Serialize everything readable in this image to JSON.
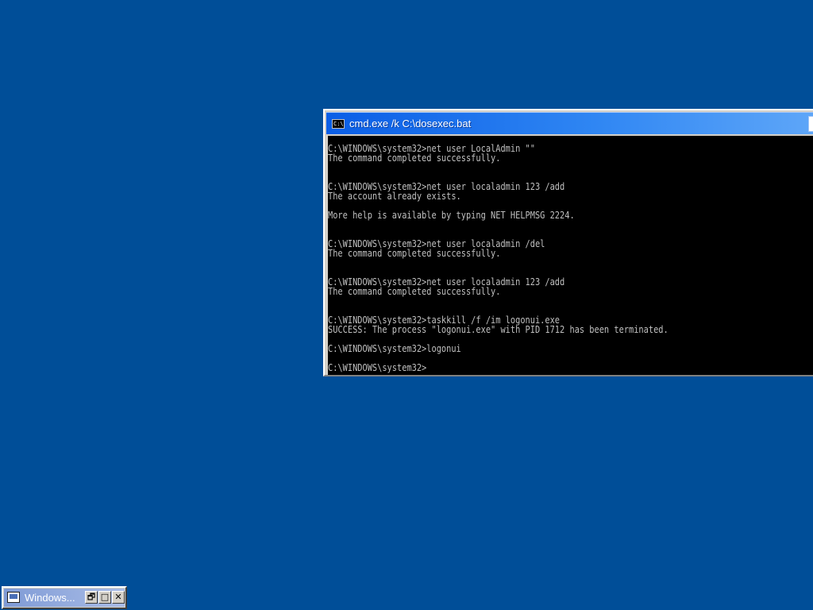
{
  "desktop": {
    "background_color": "#004e98"
  },
  "console_window": {
    "title": "cmd.exe /k C:\\dosexec.bat",
    "title_icon_label": "C:\\",
    "icon": "console-icon",
    "lines": [
      "C:\\WINDOWS\\system32>net user LocalAdmin \"\"",
      "The command completed successfully.",
      "",
      "",
      "C:\\WINDOWS\\system32>net user localadmin 123 /add",
      "The account already exists.",
      "",
      "More help is available by typing NET HELPMSG 2224.",
      "",
      "",
      "C:\\WINDOWS\\system32>net user localadmin /del",
      "The command completed successfully.",
      "",
      "",
      "C:\\WINDOWS\\system32>net user localadmin 123 /add",
      "The command completed successfully.",
      "",
      "",
      "C:\\WINDOWS\\system32>taskkill /f /im logonui.exe",
      "SUCCESS: The process \"logonui.exe\" with PID 1712 has been terminated.",
      "",
      "C:\\WINDOWS\\system32>logonui",
      "",
      "C:\\WINDOWS\\system32>"
    ]
  },
  "minimized_window": {
    "title": "Windows...",
    "icon": "computer-icon",
    "restore_glyph": "🗗",
    "maximize_glyph": "□",
    "close_glyph": "✕"
  }
}
